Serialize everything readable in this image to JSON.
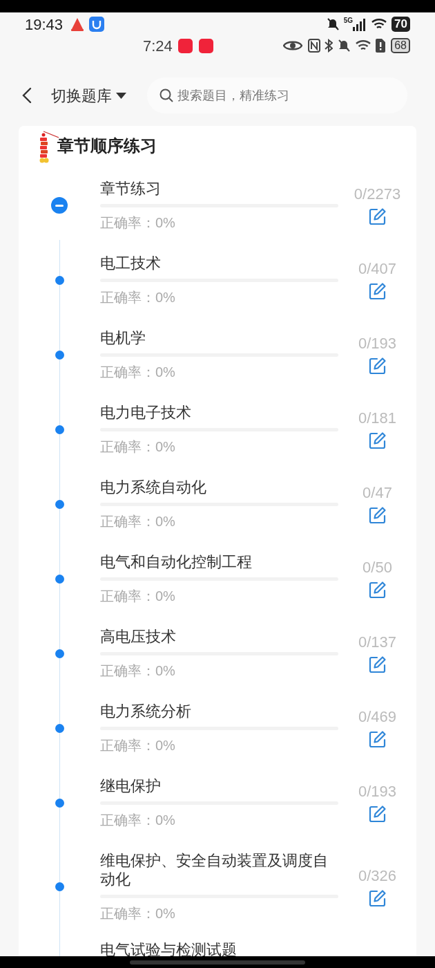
{
  "status_bar": {
    "time": "19:43",
    "network": "5G",
    "battery": "70"
  },
  "status_bar_2": {
    "time": "7:24",
    "battery": "68"
  },
  "header": {
    "title": "切换题库",
    "search": {
      "placeholder": "搜索题目，精准练习"
    }
  },
  "section": {
    "title": "章节顺序练习",
    "items": [
      {
        "title": "章节练习",
        "level": 0,
        "accuracy": "正确率：0%",
        "count": "0/2273",
        "expanded": true
      },
      {
        "title": "电工技术",
        "level": 0,
        "accuracy": "正确率：0%",
        "count": "0/407",
        "expanded": false
      },
      {
        "title": "电机学",
        "level": 0,
        "accuracy": "正确率：0%",
        "count": "0/193",
        "expanded": false
      },
      {
        "title": "电力电子技术",
        "level": 0,
        "accuracy": "正确率：0%",
        "count": "0/181",
        "expanded": false
      },
      {
        "title": "电力系统自动化",
        "level": 0,
        "accuracy": "正确率：0%",
        "count": "0/47",
        "expanded": false
      },
      {
        "title": "电气和自动化控制工程",
        "level": 0,
        "accuracy": "正确率：0%",
        "count": "0/50",
        "expanded": false
      },
      {
        "title": "高电压技术",
        "level": 0,
        "accuracy": "正确率：0%",
        "count": "0/137",
        "expanded": false
      },
      {
        "title": "电力系统分析",
        "level": 0,
        "accuracy": "正确率：0%",
        "count": "0/469",
        "expanded": false
      },
      {
        "title": "继电保护",
        "level": 0,
        "accuracy": "正确率：0%",
        "count": "0/193",
        "expanded": false
      },
      {
        "title": "维电保护、安全自动装置及调度自动化",
        "level": 0,
        "accuracy": "正确率：0%",
        "count": "0/326",
        "expanded": false
      }
    ],
    "partial_item": {
      "title": "电气试验与检测试题"
    }
  }
}
